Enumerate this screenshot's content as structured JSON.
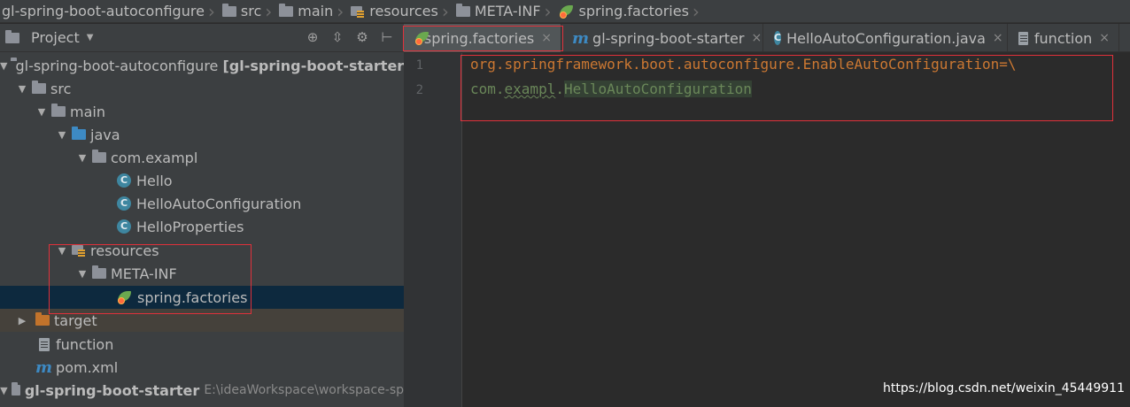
{
  "breadcrumb": [
    {
      "label": "gl-spring-boot-autoconfigure",
      "icon": "none"
    },
    {
      "label": "src",
      "icon": "folder-icon"
    },
    {
      "label": "main",
      "icon": "folder-icon"
    },
    {
      "label": "resources",
      "icon": "resources-folder-icon"
    },
    {
      "label": "META-INF",
      "icon": "folder-icon"
    },
    {
      "label": "spring.factories",
      "icon": "spring-leaf-icon"
    }
  ],
  "project_panel": {
    "title": "Project",
    "tools": [
      "target-icon",
      "collapse-icon",
      "gear-icon",
      "hide-icon"
    ],
    "tree": [
      {
        "label": "gl-spring-boot-autoconfigure",
        "suffix": "[gl-spring-boot-starter-a",
        "icon": "module-folder-icon",
        "arrow": "down"
      },
      {
        "label": "src",
        "icon": "folder-icon",
        "arrow": "down"
      },
      {
        "label": "main",
        "icon": "folder-icon",
        "arrow": "down"
      },
      {
        "label": "java",
        "icon": "source-folder-icon",
        "arrow": "down"
      },
      {
        "label": "com.exampl",
        "icon": "package-icon",
        "arrow": "down"
      },
      {
        "label": "Hello",
        "icon": "class-icon"
      },
      {
        "label": "HelloAutoConfiguration",
        "icon": "class-icon"
      },
      {
        "label": "HelloProperties",
        "icon": "class-icon"
      },
      {
        "label": "resources",
        "icon": "resources-folder-icon",
        "arrow": "down"
      },
      {
        "label": "META-INF",
        "icon": "folder-icon",
        "arrow": "down"
      },
      {
        "label": "spring.factories",
        "icon": "spring-leaf-icon",
        "selected": true
      },
      {
        "label": "target",
        "icon": "excluded-folder-icon",
        "arrow": "right"
      },
      {
        "label": "function",
        "icon": "text-file-icon"
      },
      {
        "label": "pom.xml",
        "icon": "maven-icon"
      },
      {
        "label": "gl-spring-boot-starter",
        "suffix": "E:\\ideaWorkspace\\workspace-sp",
        "icon": "module-folder-icon",
        "arrow": "down"
      }
    ]
  },
  "editor": {
    "tabs": [
      {
        "label": "spring.factories",
        "icon": "spring-leaf-icon",
        "active": true
      },
      {
        "label": "gl-spring-boot-starter",
        "icon": "maven-icon"
      },
      {
        "label": "HelloAutoConfiguration.java",
        "icon": "class-icon"
      },
      {
        "label": "function",
        "icon": "text-file-icon"
      }
    ],
    "close_glyph": "×",
    "line_numbers": [
      "1",
      "2"
    ],
    "line1": {
      "key": "org.springframework.boot.autoconfigure.EnableAutoConfiguration",
      "op": "=\\"
    },
    "line2": {
      "pkg_a": "com.",
      "pkg_b": "exampl",
      "pkg_c": ".",
      "cls": "HelloAutoConfiguration"
    }
  },
  "watermark": "https://blog.csdn.net/weixin_45449911",
  "colors": {
    "highlight_box": "#e0313b",
    "keyword": "#cc7832",
    "value": "#6a8759",
    "selection": "#0d293e"
  }
}
